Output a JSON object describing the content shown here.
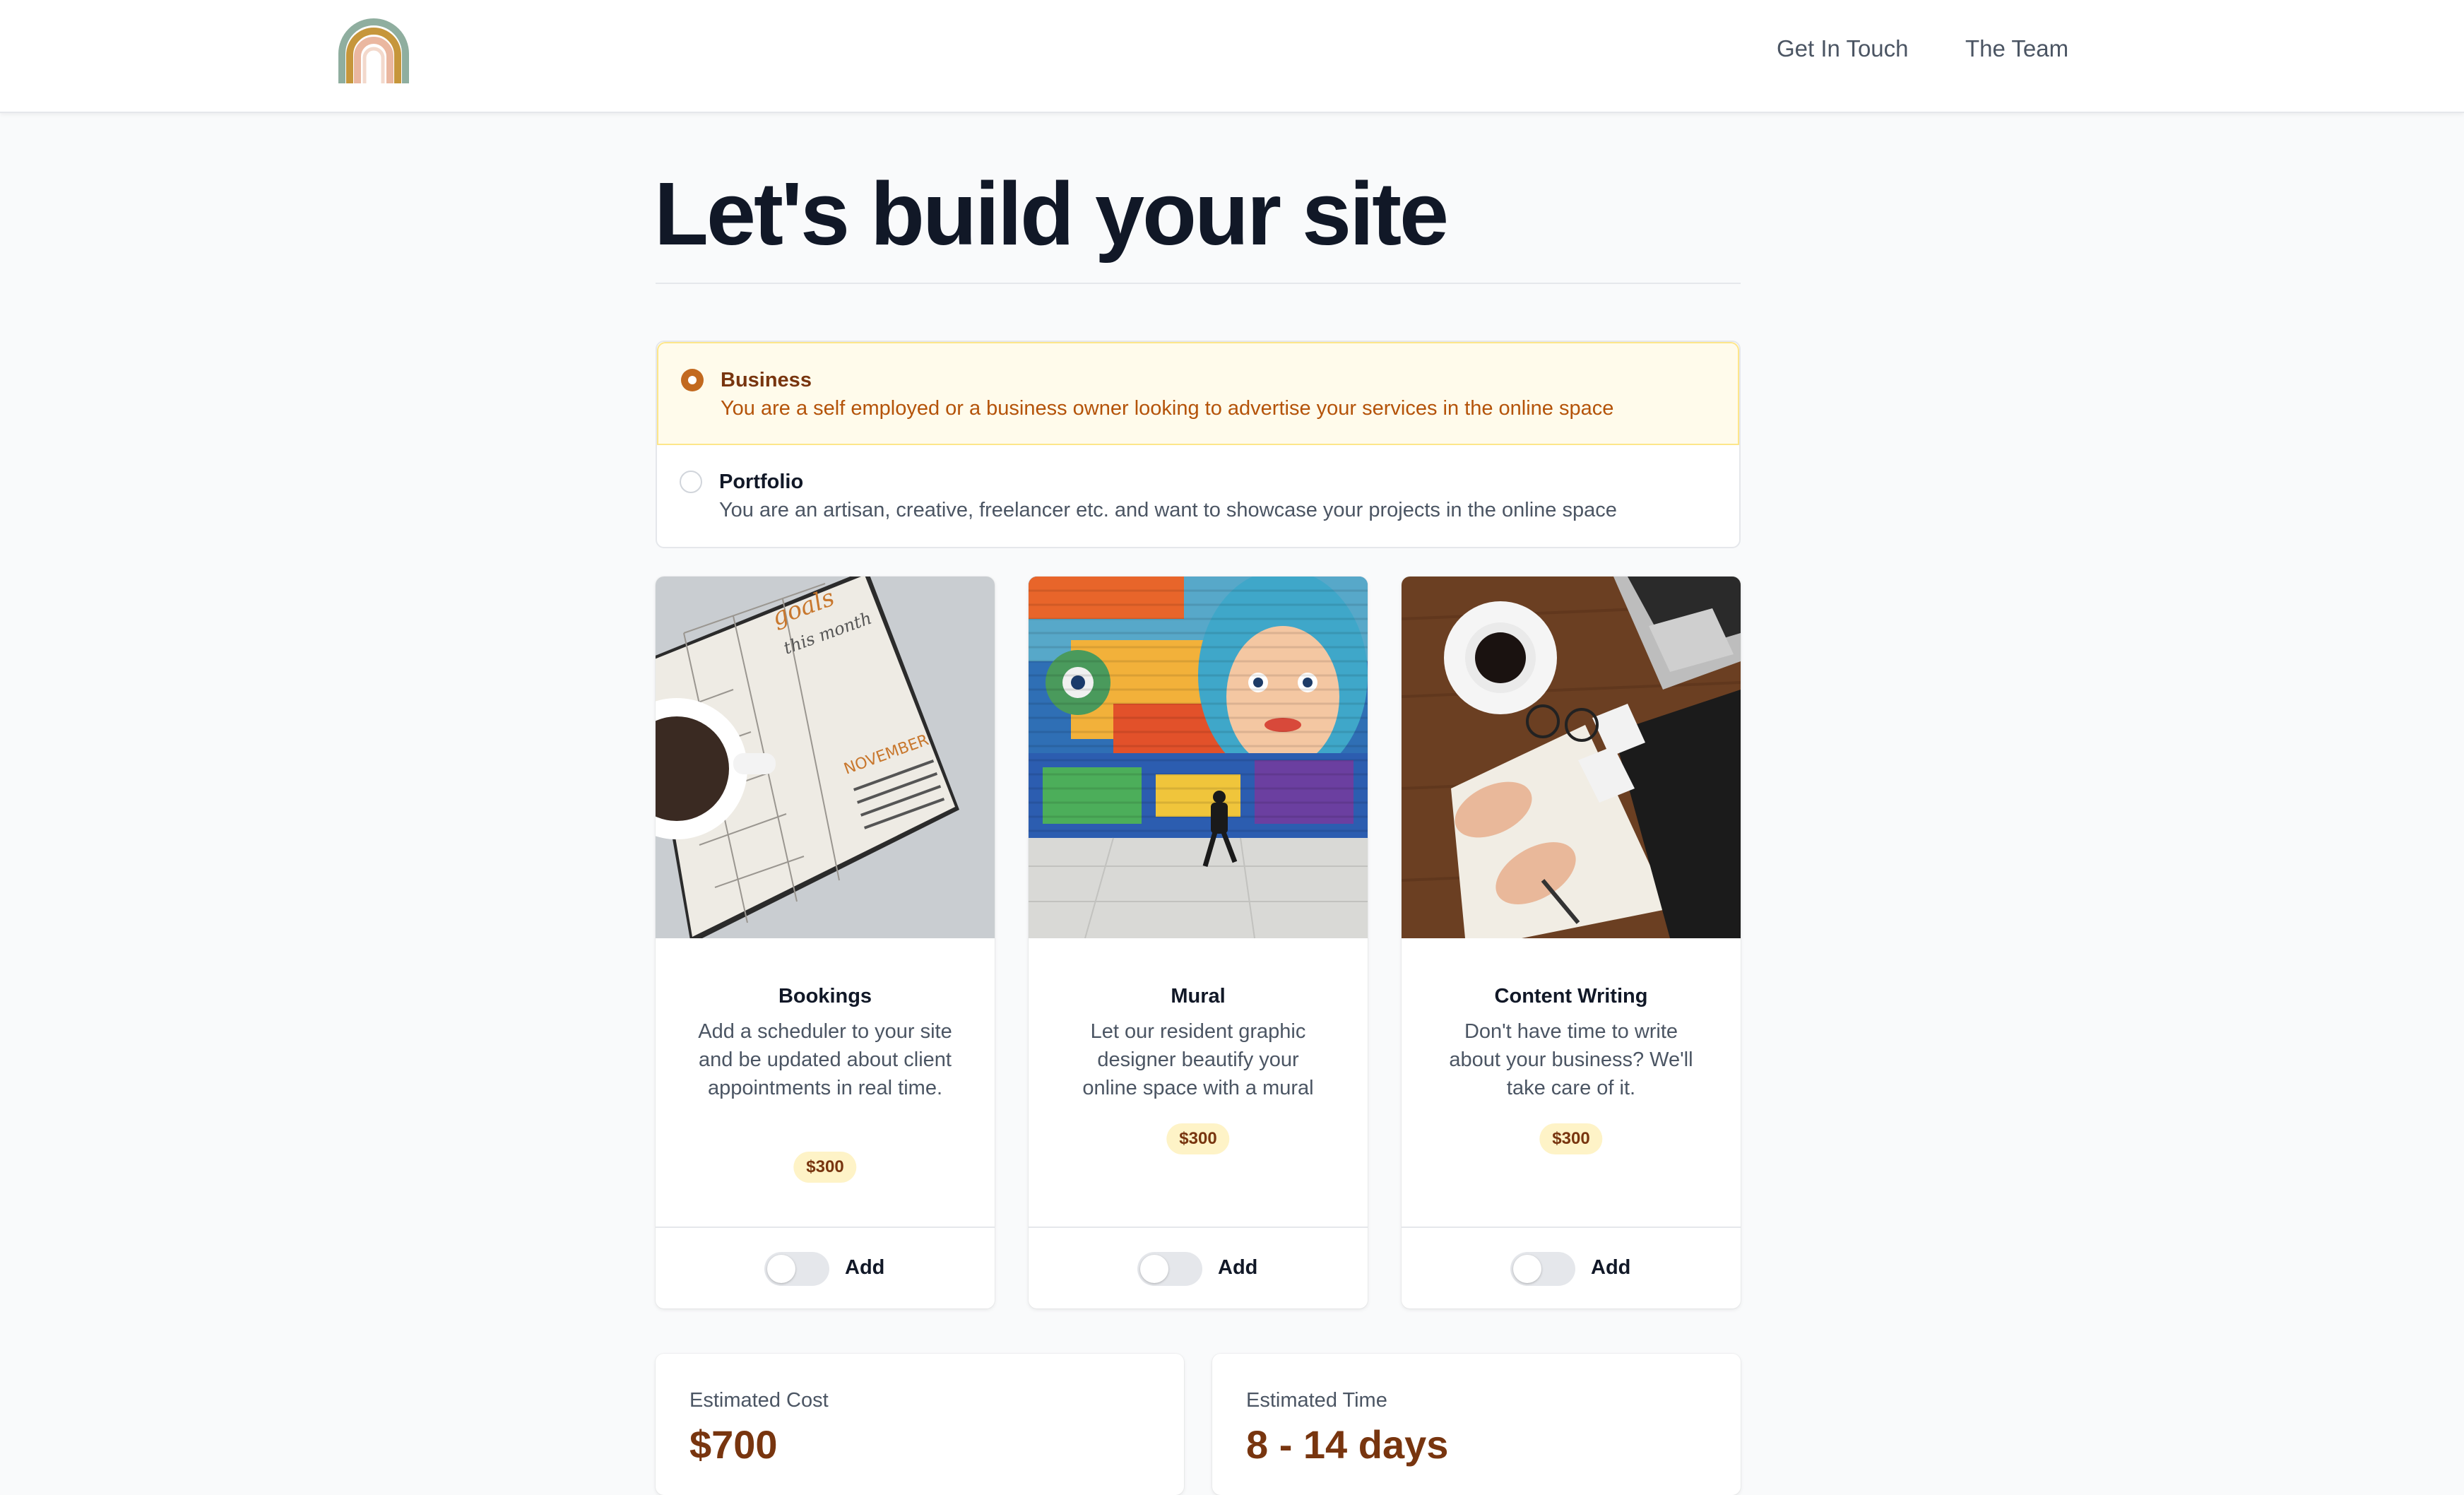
{
  "header": {
    "nav": [
      {
        "label": "Get In Touch"
      },
      {
        "label": "The Team"
      }
    ]
  },
  "main": {
    "title": "Let's build your site",
    "site_types": [
      {
        "label": "Business",
        "description": "You are a self employed or a business owner looking to advertise your services in the online space",
        "selected": true
      },
      {
        "label": "Portfolio",
        "description": "You are an artisan, creative, freelancer etc. and want to showcase your projects in the online space",
        "selected": false
      }
    ],
    "addons": [
      {
        "title": "Bookings",
        "description": "Add a scheduler to your site and be updated about client appointments in real time.",
        "price": "$300",
        "toggle_label": "Add",
        "enabled": false
      },
      {
        "title": "Mural",
        "description": "Let our resident graphic designer beautify your online space with a mural",
        "price": "$300",
        "toggle_label": "Add",
        "enabled": false
      },
      {
        "title": "Content Writing",
        "description": "Don't have time to write about your business? We'll take care of it.",
        "price": "$300",
        "toggle_label": "Add",
        "enabled": false
      }
    ],
    "estimates": {
      "cost": {
        "label": "Estimated Cost",
        "value": "$700"
      },
      "time": {
        "label": "Estimated Time",
        "value": "8 - 14 days"
      }
    }
  },
  "colors": {
    "accent": "#c2691f",
    "selected_bg": "#fffbeb",
    "badge_bg": "#fef3c7",
    "badge_text": "#78350f",
    "title_text": "#111827"
  }
}
